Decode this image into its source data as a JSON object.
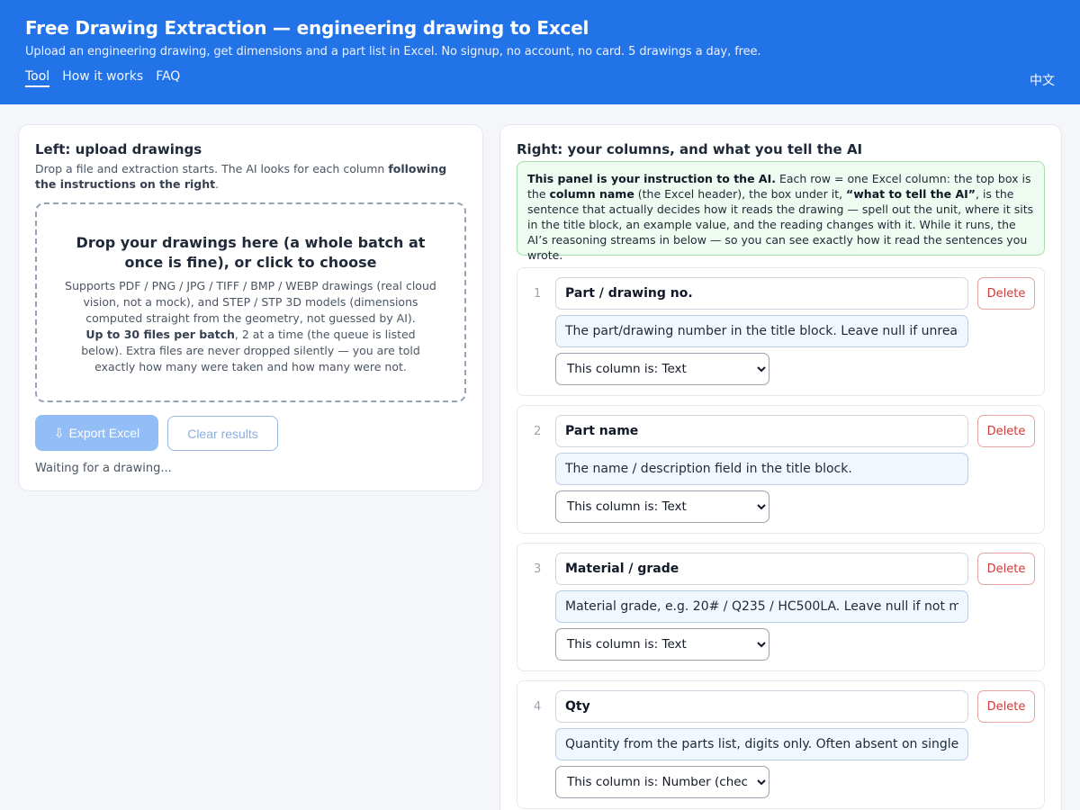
{
  "header": {
    "title": "Free Drawing Extraction — engineering drawing to Excel",
    "subtitle": "Upload an engineering drawing, get dimensions and a part list in Excel. No signup, no account, no card. 5 drawings a day, free.",
    "nav": [
      "Tool",
      "How it works",
      "FAQ"
    ],
    "language": "中文"
  },
  "left": {
    "heading": "Left: upload drawings",
    "desc_a": "Drop a file and extraction starts. The AI looks for each column ",
    "desc_b": "following the instructions on the right",
    "desc_c": ".",
    "drop_title": "Drop your drawings here (a whole batch at once is fine), or click to choose",
    "drop_a": "Supports PDF / PNG / JPG / TIFF / BMP / WEBP drawings (real cloud vision, not a mock), and STEP / STP 3D models (dimensions computed straight from the geometry, not guessed by AI).",
    "drop_b": "Up to 30 files per batch",
    "drop_c": ", 2 at a time (the queue is listed below). Extra files are never dropped silently — you are told exactly how many were taken and how many were not.",
    "export_icon": "⇩",
    "export_label": "Export Excel",
    "clear_label": "Clear results",
    "status": "Waiting for a drawing..."
  },
  "right": {
    "heading": "Right: your columns, and what you tell the AI",
    "note_a": "This panel is your instruction to the AI.",
    "note_b": " Each row = one Excel column: the top box is the ",
    "note_c": "column name",
    "note_d": " (the Excel header), the box under it, ",
    "note_e": "“what to tell the AI”",
    "note_f": ", is the sentence that actually decides how it reads the drawing — spell out the unit, where it sits in the title block, an example value, and the reading changes with it. While it runs, the AI’s reasoning streams in below — so you can see exactly how it read the sentences you wrote.",
    "delete_label": "Delete",
    "columns": [
      {
        "num": "1",
        "name": "Part / drawing no.",
        "instruction": "The part/drawing number in the title block. Leave null if unreadable; never guess.",
        "type": "This column is: Text"
      },
      {
        "num": "2",
        "name": "Part name",
        "instruction": "The name / description field in the title block.",
        "type": "This column is: Text"
      },
      {
        "num": "3",
        "name": "Material / grade",
        "instruction": "Material grade, e.g. 20# / Q235 / HC500LA. Leave null if not marked.",
        "type": "This column is: Text"
      },
      {
        "num": "4",
        "name": "Qty",
        "instruction": "Quantity from the parts list, digits only. Often absent on single-part drawings.",
        "type": "This column is: Number (checked)"
      }
    ]
  },
  "colors": {
    "header_bg": "#2272e8",
    "note_bg": "#eefbf0",
    "delete_text": "#d03a3a",
    "export_bg": "#93bdf6"
  }
}
